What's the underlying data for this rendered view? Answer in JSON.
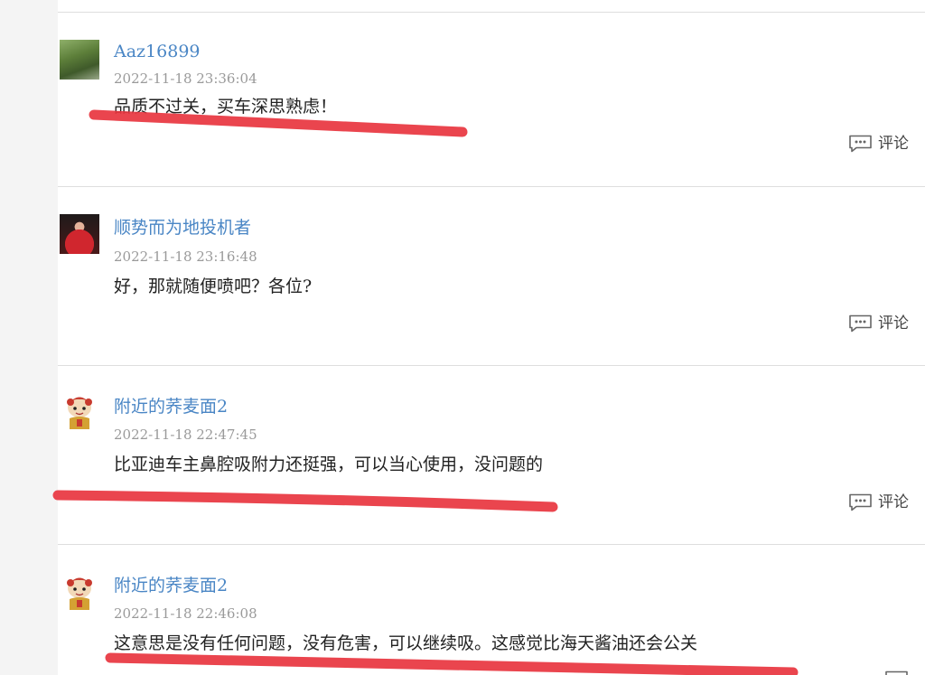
{
  "reply_label": "评论",
  "icons": {
    "reply": "comment-bubble-icon"
  },
  "colors": {
    "username": "#4a86c5",
    "timestamp": "#9a9a9a",
    "content": "#222222",
    "highlight": "#e8353f",
    "divider": "#dedede"
  },
  "comments": [
    {
      "user": "Aaz16899",
      "time": "2022-11-18 23:36:04",
      "text": "品质不过关，买车深思熟虑！",
      "avatar": "plant-photo",
      "underlined": true
    },
    {
      "user": "顺势而为地投机者",
      "time": "2022-11-18 23:16:48",
      "text": "好，那就随便喷吧？各位?",
      "avatar": "woman-in-red-photo",
      "underlined": false
    },
    {
      "user": "附近的荞麦面2",
      "time": "2022-11-18 22:47:45",
      "text": "比亚迪车主鼻腔吸附力还挺强，可以当心使用，没问题的",
      "avatar": "cartoon-doll",
      "underlined": true
    },
    {
      "user": "附近的荞麦面2",
      "time": "2022-11-18 22:46:08",
      "text": "这意思是没有任何问题，没有危害，可以继续吸。这感觉比海天酱油还会公关",
      "avatar": "cartoon-doll",
      "underlined": true
    }
  ]
}
